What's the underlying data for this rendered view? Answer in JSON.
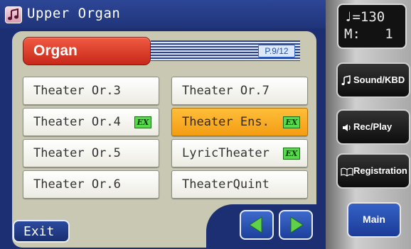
{
  "header": {
    "title": "Upper Organ",
    "icon": "music-note-icon"
  },
  "category": {
    "label": "Organ",
    "page": "P.9/12"
  },
  "tones": [
    {
      "label": "Theater Or.3",
      "ex": "",
      "selected": false
    },
    {
      "label": "Theater Or.7",
      "ex": "",
      "selected": false
    },
    {
      "label": "Theater Or.4",
      "ex": "EX",
      "selected": false
    },
    {
      "label": "Theater Ens.",
      "ex": "EX",
      "selected": true
    },
    {
      "label": "Theater Or.5",
      "ex": "",
      "selected": false
    },
    {
      "label": "LyricTheater",
      "ex": "EX",
      "selected": false
    },
    {
      "label": "Theater Or.6",
      "ex": "",
      "selected": false
    },
    {
      "label": "TheaterQuint",
      "ex": "",
      "selected": false
    }
  ],
  "footer": {
    "exit_label": "Exit"
  },
  "tempo": {
    "line1": "♩=130",
    "line2": "M:   1"
  },
  "side_buttons": [
    {
      "label": "Sound/KBD",
      "icon": "sound-kbd-icon"
    },
    {
      "label": "Rec/Play",
      "icon": "speaker-icon"
    },
    {
      "label": "Registration",
      "icon": "book-icon"
    }
  ],
  "main_button": {
    "label": "Main"
  },
  "colors": {
    "accent": "#f7a81b",
    "ex_badge": "#56d94a",
    "category": "#e2402b",
    "frame": "#1c2f73"
  }
}
